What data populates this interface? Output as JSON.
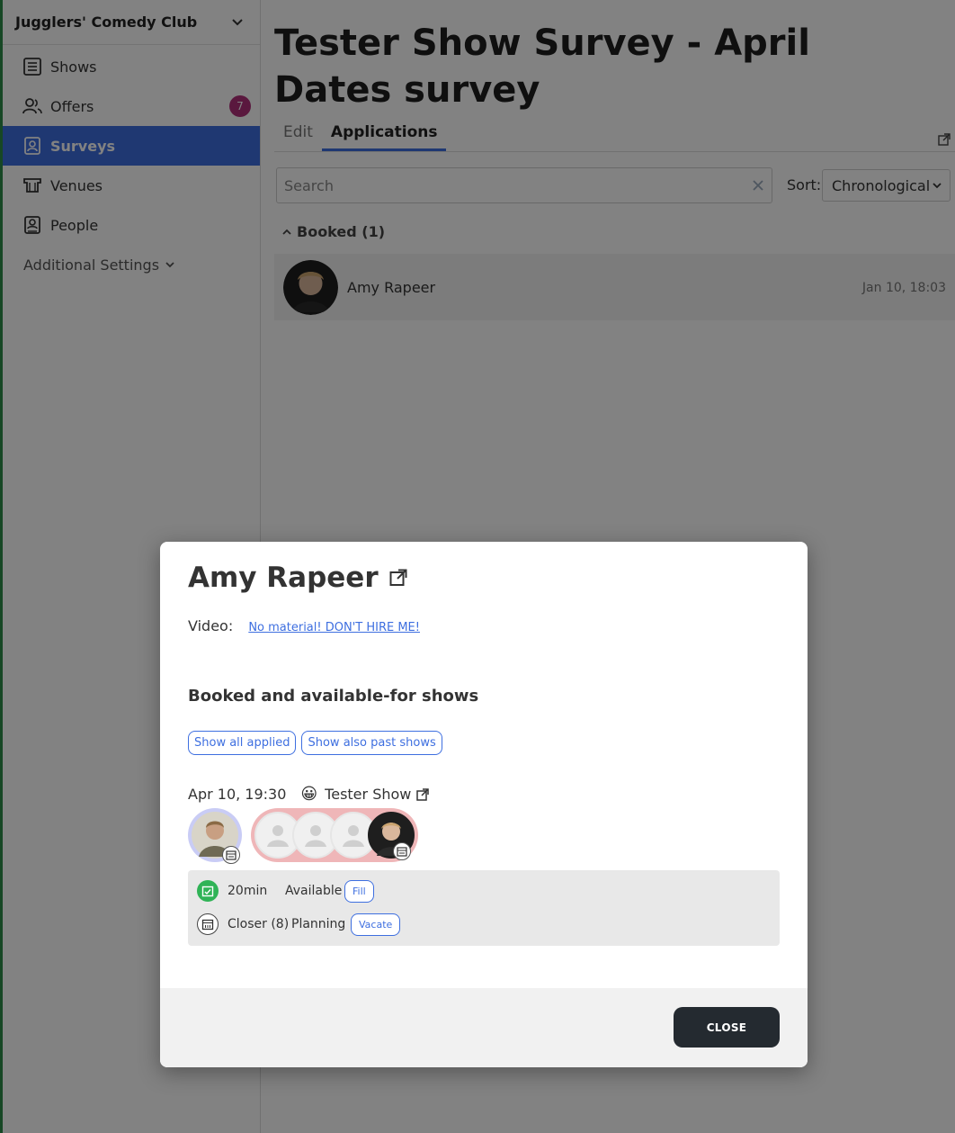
{
  "sidebar": {
    "org_name": "Jugglers' Comedy Club",
    "items": [
      {
        "label": "Shows",
        "icon": "list-icon"
      },
      {
        "label": "Offers",
        "icon": "people-icon",
        "badge": "7"
      },
      {
        "label": "Surveys",
        "icon": "survey-icon",
        "active": true
      },
      {
        "label": "Venues",
        "icon": "venue-icon"
      },
      {
        "label": "People",
        "icon": "contact-card-icon"
      }
    ],
    "additional_settings": "Additional Settings"
  },
  "main": {
    "title": "Tester Show Survey - April Dates survey",
    "tabs": [
      {
        "label": "Edit"
      },
      {
        "label": "Applications",
        "active": true
      }
    ],
    "search_placeholder": "Search",
    "sort_label": "Sort:",
    "sort_value": "Chronological",
    "group_label": "Booked (1)",
    "rows": [
      {
        "name": "Amy Rapeer",
        "date": "Jan 10, 18:03"
      }
    ]
  },
  "modal": {
    "title": "Amy Rapeer",
    "video_label": "Video:",
    "video_link": "No material! DON'T HIRE ME!",
    "section_title": "Booked and available-for shows",
    "buttons": {
      "show_all_applied": "Show all applied",
      "show_past": "Show also past shows"
    },
    "show": {
      "datetime": "Apr 10, 19:30",
      "emoji": "😀",
      "name": "Tester Show"
    },
    "slots": [
      {
        "duration": "20min",
        "status": "Available",
        "action": "Fill",
        "icon_color": "#2fb356"
      },
      {
        "duration": "Closer (8)",
        "status": "Planning",
        "action": "Vacate",
        "icon_color": "#ffffff"
      }
    ],
    "close_label": "CLOSE"
  },
  "colors": {
    "accent": "#3e6fe0",
    "badge": "#b0307a",
    "close_button": "#242a30",
    "brand_edge": "#2e8b4a"
  }
}
